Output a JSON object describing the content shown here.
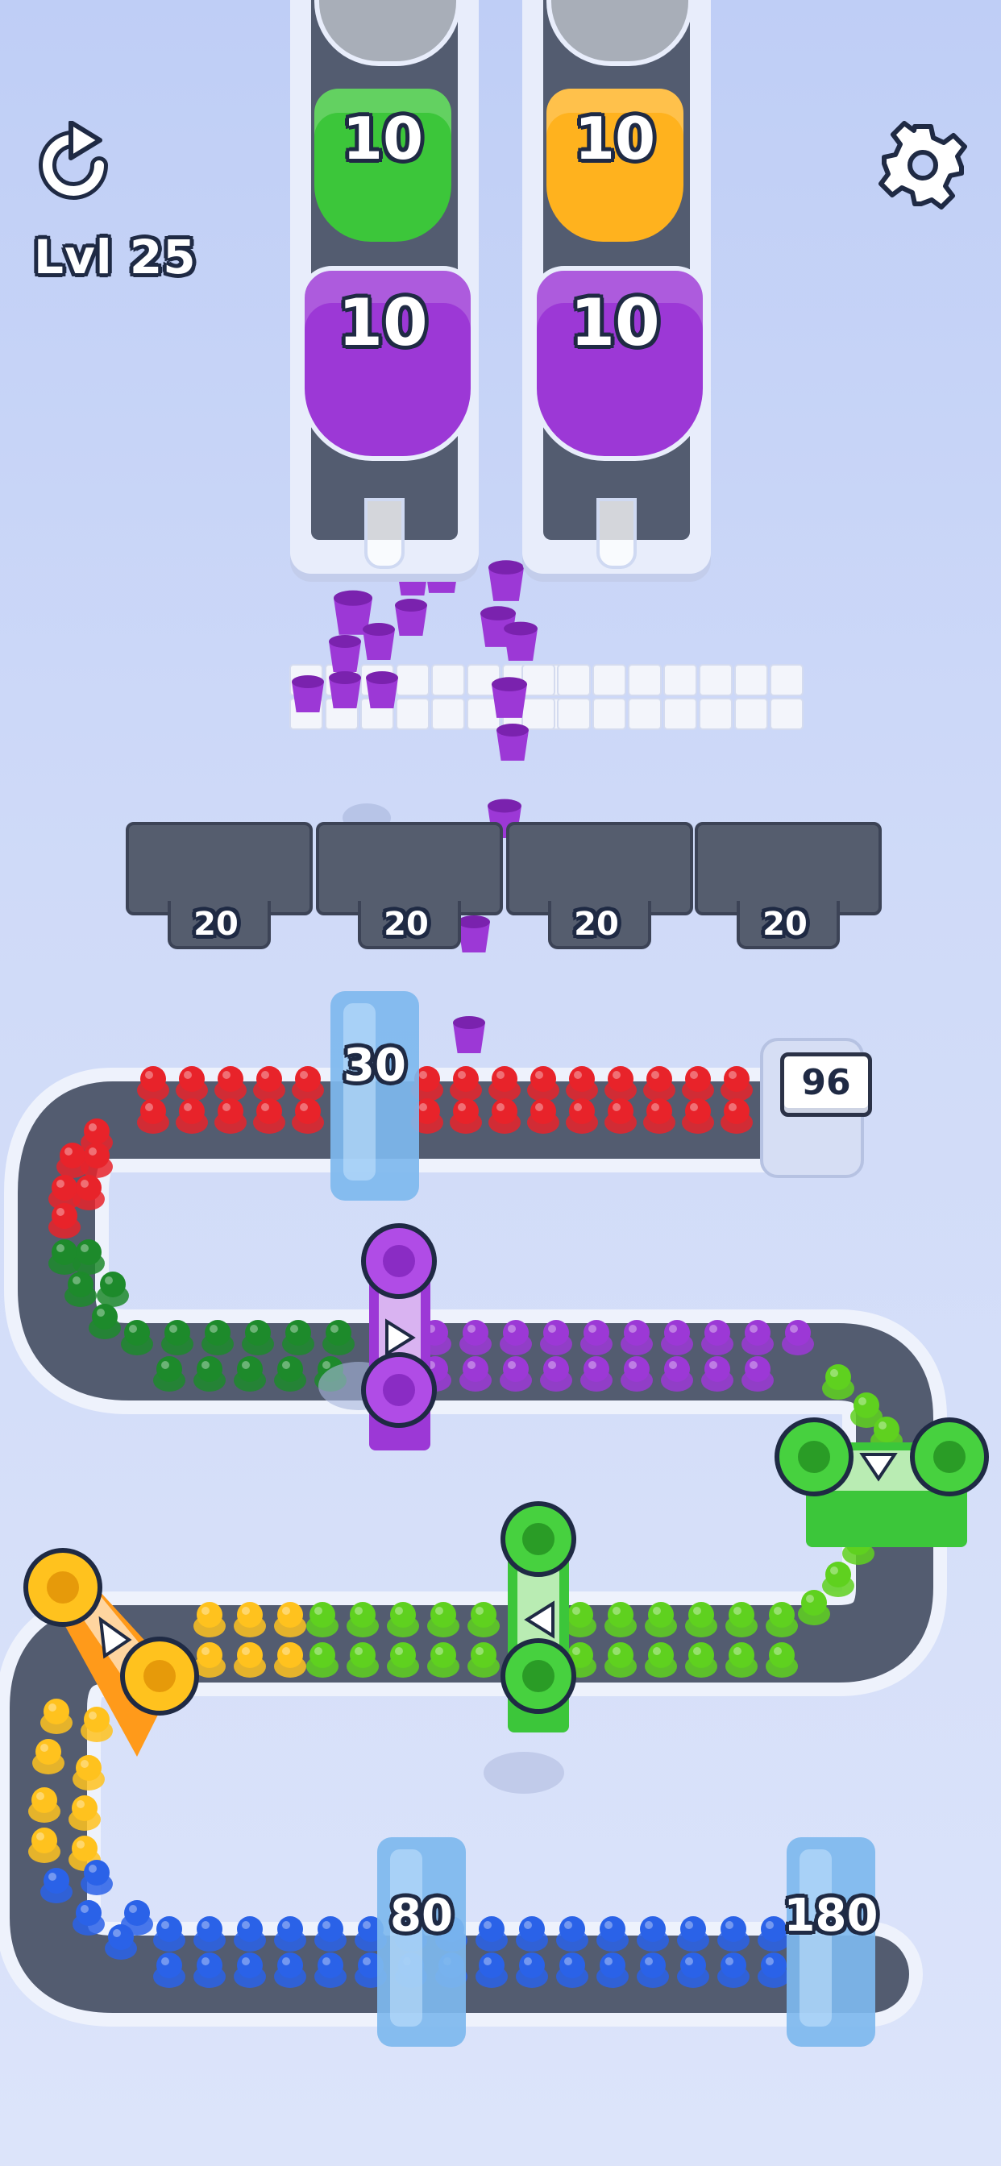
{
  "hud": {
    "level_label": "Lvl 25",
    "restart_icon": "restart-icon",
    "settings_icon": "gear-icon"
  },
  "trays": [
    {
      "cups": [
        {
          "value": "10",
          "color": "#3cc63a"
        },
        {
          "value": "10",
          "color": "#9c38d6"
        }
      ]
    },
    {
      "cups": [
        {
          "value": "10",
          "color": "#ffb21e"
        },
        {
          "value": "10",
          "color": "#9c38d6"
        }
      ]
    }
  ],
  "slots": [
    "20",
    "20",
    "20",
    "20"
  ],
  "ice_blocks": [
    "30",
    "80",
    "180"
  ],
  "conveyor_counter": "96",
  "colors": {
    "red": "#e8232a",
    "dark_green": "#1d8a2b",
    "purple": "#9c38d6",
    "light_green": "#5fd11f",
    "bright_green": "#3cc63a",
    "yellow": "#ffc21e",
    "blue": "#2a62e8",
    "ice": "#8fc6f2",
    "belt": "#535c70"
  }
}
